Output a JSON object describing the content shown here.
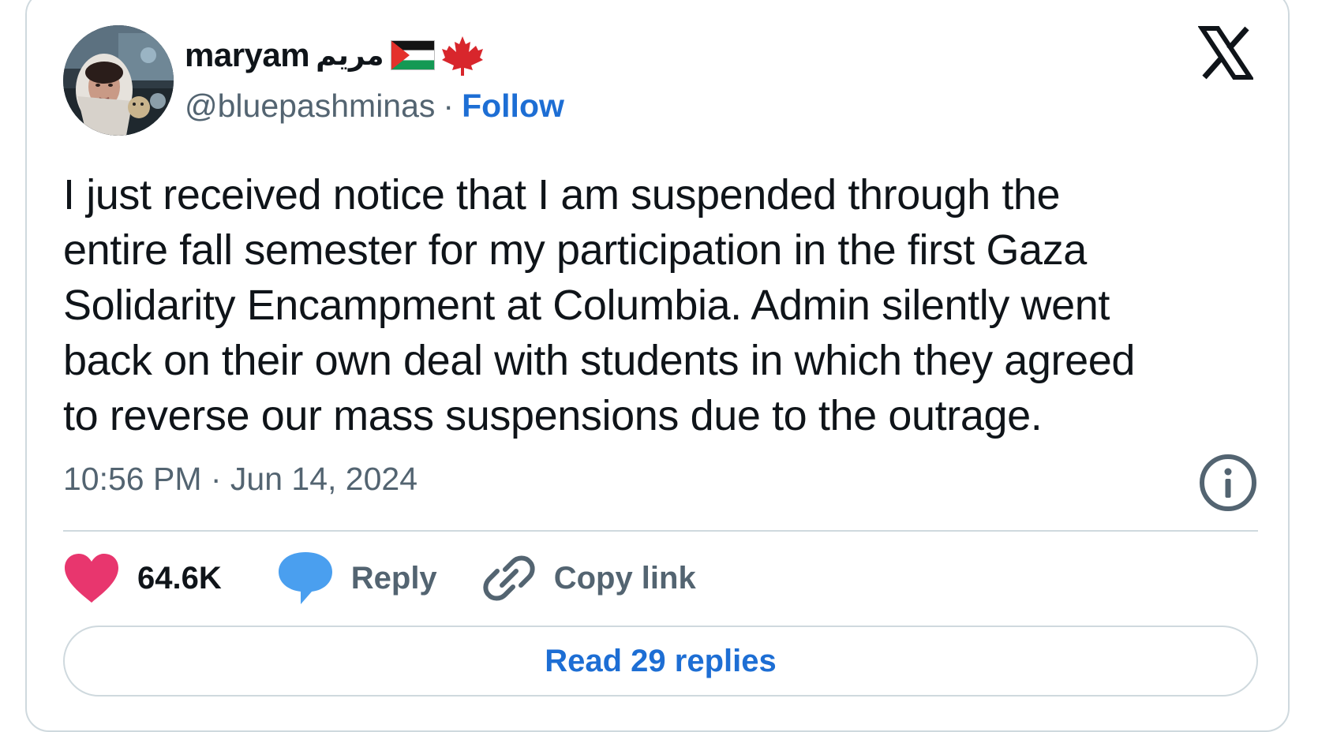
{
  "author": {
    "display_name": "maryam",
    "arabic_name": "مريم",
    "handle": "@bluepashminas",
    "separator": "·",
    "follow_label": "Follow",
    "avatar_icon": "profile-photo",
    "flag_icons": [
      "palestine-flag-icon",
      "maple-leaf-icon"
    ]
  },
  "brand": {
    "logo_icon": "x-logo-icon"
  },
  "tweet": {
    "text": "I just received notice that I am suspended through the\nentire fall semester for my participation in the first Gaza\nSolidarity Encampment at Columbia. Admin silently went\nback on their own deal with students in which they agreed\nto reverse our mass suspensions due to the outrage.",
    "timestamp": "10:56 PM · Jun 14, 2024"
  },
  "actions": {
    "like_count": "64.6K",
    "reply_label": "Reply",
    "copy_link_label": "Copy link"
  },
  "footer": {
    "read_replies_label": "Read 29 replies"
  },
  "colors": {
    "like": "#e8366e",
    "reply": "#4a9fef",
    "link": "#1d6ed4",
    "secondary_text": "#536471",
    "border": "#cfd9de"
  }
}
